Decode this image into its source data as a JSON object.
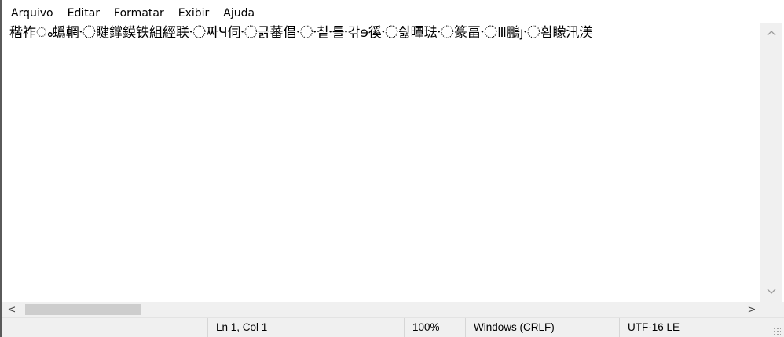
{
  "menubar": {
    "items": [
      "Arquivo",
      "Editar",
      "Formatar",
      "Exibir",
      "Ajuda"
    ]
  },
  "editor": {
    "content": "稭祚ം蟡輞〮睷鐣鏌铁組經联〮짜Ч伺〮긁蕃倡〮칱〮틀〮갂〮ɘ徯〮싏曋琺〮篆畐〮Ⅲ鵬ȷ〮횜矇汛渼"
  },
  "scrollbars": {
    "vertical": {
      "up_icon": "chevron-up-icon",
      "down_icon": "chevron-down-icon"
    },
    "horizontal": {
      "left_label": "<",
      "right_label": ">"
    }
  },
  "statusbar": {
    "position": "Ln 1, Col 1",
    "zoom": "100%",
    "line_ending": "Windows (CRLF)",
    "encoding": "UTF-16 LE"
  }
}
